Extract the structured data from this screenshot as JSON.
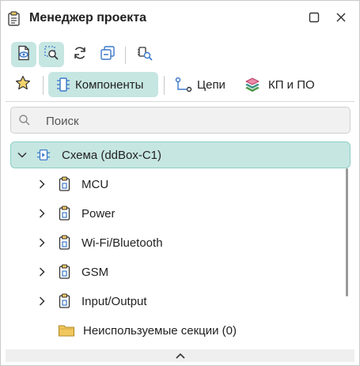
{
  "window": {
    "title": "Менеджер проекта",
    "title_icon": "project-manager-icon",
    "maximize_icon": "maximize-icon",
    "close_icon": "close-icon"
  },
  "toolbar": {
    "buttons": [
      {
        "icon": "document-eye-icon",
        "active": true
      },
      {
        "icon": "select-search-icon",
        "active": true
      },
      {
        "icon": "refresh-icon",
        "active": false
      },
      {
        "icon": "collapse-all-icon",
        "active": false
      },
      {
        "icon": "find-component-icon",
        "active": false
      }
    ]
  },
  "tabs": {
    "favorites_icon": "star-icon",
    "components": "Компоненты",
    "nets": "Цепи",
    "pcb_sw": "КП и ПО"
  },
  "search": {
    "placeholder": "Поиск",
    "value": ""
  },
  "tree": {
    "root": "Схема (ddBox-C1)",
    "children": [
      {
        "label": "MCU"
      },
      {
        "label": "Power"
      },
      {
        "label": "Wi-Fi/Bluetooth"
      },
      {
        "label": "GSM"
      },
      {
        "label": "Input/Output"
      }
    ],
    "unused": "Неиспользуемые секции (0)"
  },
  "colors": {
    "accent_bg": "#c6e6e2",
    "accent_border": "#8ccfc6",
    "icon_blue": "#3a78c9",
    "folder_yellow": "#f0c75e"
  }
}
